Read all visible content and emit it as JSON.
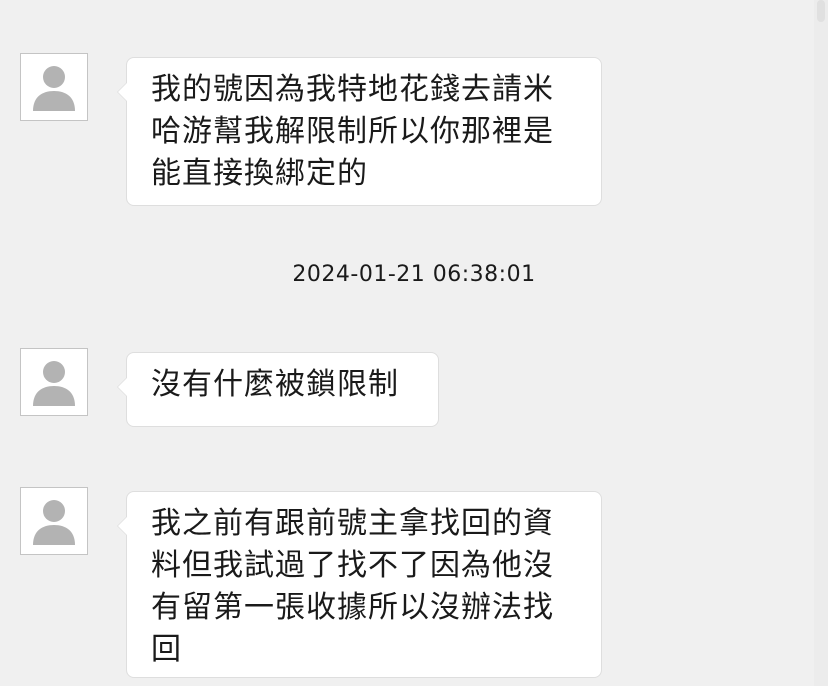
{
  "messages": [
    {
      "avatar": "default-user-icon",
      "text": "我的號因為我特地花錢去請米哈游幫我解限制所以你那裡是能直接換綁定的"
    },
    {
      "avatar": "default-user-icon",
      "text": "沒有什麼被鎖限制"
    },
    {
      "avatar": "default-user-icon",
      "text": "我之前有跟前號主拿找回的資料但我試過了找不了因為他沒有留第一張收據所以沒辦法找回"
    }
  ],
  "timestamp": "2024-01-21 06:38:01",
  "colors": {
    "background": "#f0f0f0",
    "bubble": "#ffffff",
    "bubble_border": "#dedede",
    "avatar_silhouette": "#b3b3b3"
  }
}
